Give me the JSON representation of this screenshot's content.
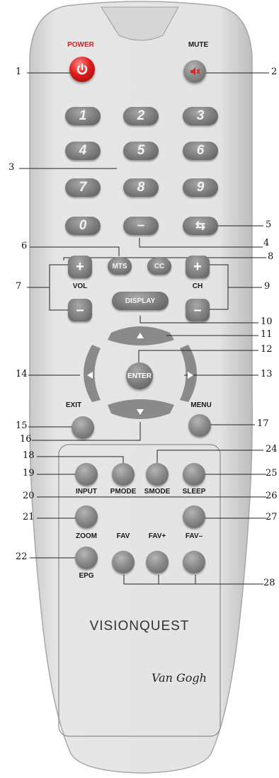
{
  "labels": {
    "power": "POWER",
    "mute": "MUTE",
    "vol": "VOL",
    "ch": "CH",
    "exit": "EXIT",
    "menu": "MENU",
    "input": "INPUT",
    "pmode": "PMODE",
    "smode": "SMODE",
    "sleep": "SLEEP",
    "zoom": "ZOOM",
    "fav": "FAV",
    "fav_plus": "FAV+",
    "fav_minus": "FAV–",
    "epg": "EPG"
  },
  "keys": {
    "digits": [
      "1",
      "2",
      "3",
      "4",
      "5",
      "6",
      "7",
      "8",
      "9",
      "0"
    ],
    "dash": "–",
    "mts": "MTS",
    "cc": "CC",
    "vol_up": "+",
    "vol_down": "–",
    "ch_up": "+",
    "ch_down": "–",
    "display": "DISPLAY",
    "enter": "ENTER",
    "recall": "⇆"
  },
  "callouts": [
    "1",
    "2",
    "3",
    "4",
    "5",
    "6",
    "7",
    "8",
    "9",
    "10",
    "11",
    "12",
    "13",
    "14",
    "15",
    "16",
    "17",
    "18",
    "19",
    "20",
    "21",
    "22",
    "24",
    "25",
    "26",
    "27",
    "28"
  ],
  "brand": {
    "logo": "VISIONQUEST",
    "signature": "Van Gogh"
  },
  "icons": {
    "power": "power-icon",
    "mute": "speaker-muted-icon",
    "up": "arrow-up-icon",
    "down": "arrow-down-icon",
    "left": "arrow-left-icon",
    "right": "arrow-right-icon"
  },
  "colors": {
    "body": "#e3e3e3",
    "button": "#8a8a8a",
    "power": "#e01b1b"
  }
}
